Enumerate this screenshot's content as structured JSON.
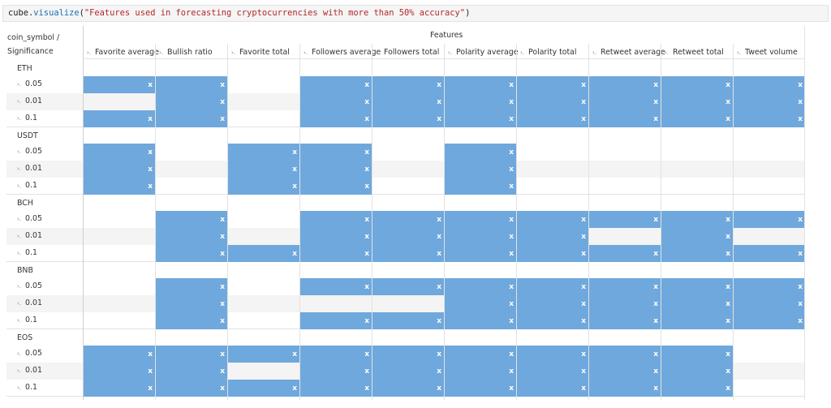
{
  "code": {
    "object": "cube",
    "method": "visualize",
    "argument": "\"Features used in forecasting cryptocurrencies with more than 50% accuracy\""
  },
  "table": {
    "row_header_label_line1": "coin_symbol /",
    "row_header_label_line2": "Significance",
    "group_header": "Features",
    "columns": [
      "Favorite average",
      "Bullish ratio",
      "Favorite total",
      "Followers average",
      "Followers total",
      "Polarity average",
      "Polarity total",
      "Retweet average",
      "Retweet total",
      "Tweet volume"
    ],
    "mark": "x",
    "coins": [
      {
        "symbol": "ETH",
        "rows": [
          {
            "level": "0.05",
            "cells": [
              1,
              1,
              0,
              1,
              1,
              1,
              1,
              1,
              1,
              1
            ]
          },
          {
            "level": "0.01",
            "cells": [
              0,
              1,
              0,
              1,
              1,
              1,
              1,
              1,
              1,
              1
            ]
          },
          {
            "level": "0.1",
            "cells": [
              1,
              1,
              0,
              1,
              1,
              1,
              1,
              1,
              1,
              1
            ]
          }
        ]
      },
      {
        "symbol": "USDT",
        "rows": [
          {
            "level": "0.05",
            "cells": [
              1,
              0,
              1,
              1,
              0,
              1,
              0,
              0,
              0,
              0
            ]
          },
          {
            "level": "0.01",
            "cells": [
              1,
              0,
              1,
              1,
              0,
              1,
              0,
              0,
              0,
              0
            ]
          },
          {
            "level": "0.1",
            "cells": [
              1,
              0,
              1,
              1,
              0,
              1,
              0,
              0,
              0,
              0
            ]
          }
        ]
      },
      {
        "symbol": "BCH",
        "rows": [
          {
            "level": "0.05",
            "cells": [
              0,
              1,
              0,
              1,
              1,
              1,
              1,
              1,
              1,
              1
            ]
          },
          {
            "level": "0.01",
            "cells": [
              0,
              1,
              0,
              1,
              1,
              1,
              1,
              0,
              1,
              0
            ]
          },
          {
            "level": "0.1",
            "cells": [
              0,
              1,
              1,
              1,
              1,
              1,
              1,
              1,
              1,
              1
            ]
          }
        ]
      },
      {
        "symbol": "BNB",
        "rows": [
          {
            "level": "0.05",
            "cells": [
              0,
              1,
              0,
              1,
              1,
              1,
              1,
              1,
              1,
              1
            ]
          },
          {
            "level": "0.01",
            "cells": [
              0,
              1,
              0,
              0,
              0,
              1,
              1,
              1,
              1,
              1
            ]
          },
          {
            "level": "0.1",
            "cells": [
              0,
              1,
              0,
              1,
              1,
              1,
              1,
              1,
              1,
              1
            ]
          }
        ]
      },
      {
        "symbol": "EOS",
        "rows": [
          {
            "level": "0.05",
            "cells": [
              1,
              1,
              1,
              1,
              1,
              1,
              1,
              1,
              1,
              0
            ]
          },
          {
            "level": "0.01",
            "cells": [
              1,
              1,
              0,
              1,
              1,
              1,
              1,
              1,
              1,
              0
            ]
          },
          {
            "level": "0.1",
            "cells": [
              1,
              1,
              1,
              1,
              1,
              1,
              1,
              1,
              1,
              0
            ]
          }
        ]
      }
    ],
    "colors": {
      "fill": "#6fa8dc",
      "mark": "#ffffff",
      "grid": "#e2e2e2",
      "band": "#f4f4f4"
    }
  }
}
